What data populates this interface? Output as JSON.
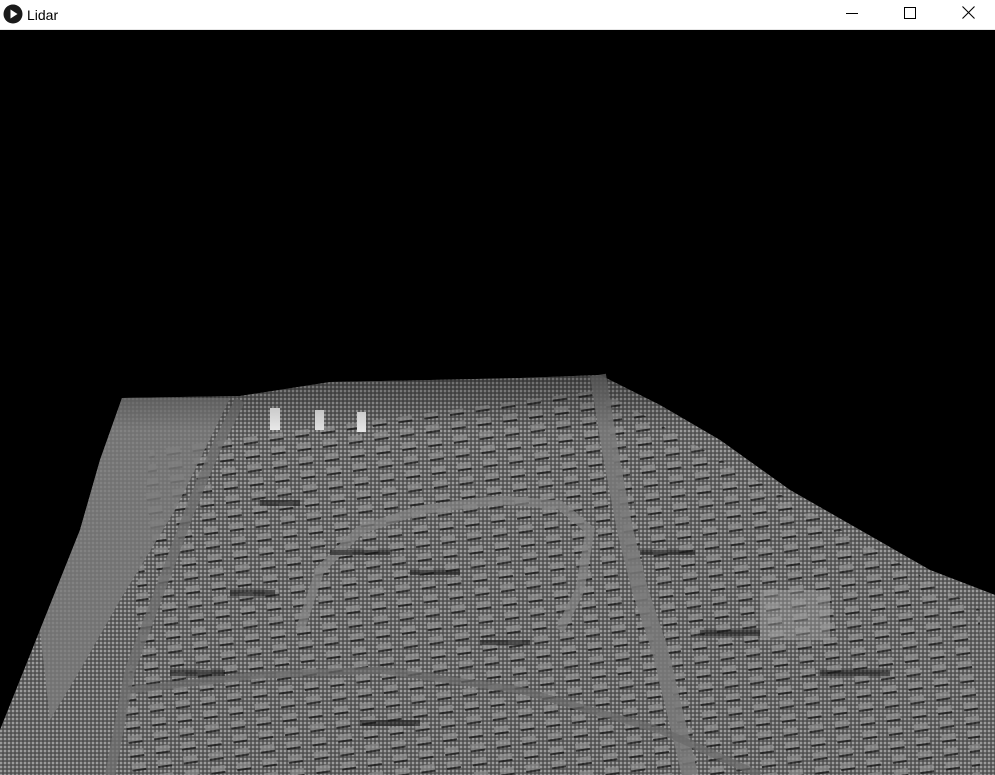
{
  "window": {
    "title": "Lidar",
    "app_icon": "play-circle-icon",
    "controls": {
      "minimize_icon": "minimize-icon",
      "maximize_icon": "maximize-icon",
      "close_icon": "close-icon"
    }
  },
  "viewport": {
    "content": "lidar-point-cloud",
    "background_color": "#000000",
    "point_color": "#8a8a8a"
  }
}
